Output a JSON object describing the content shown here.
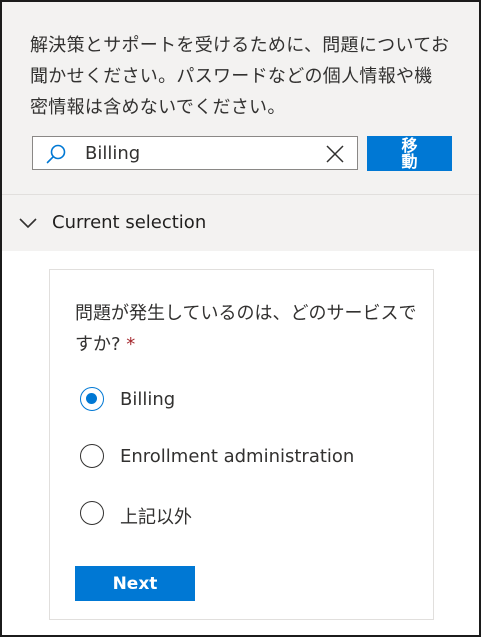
{
  "help": {
    "intro": "解決策とサポートを受けるために、問題についてお聞かせください。パスワードなどの個人情報や機密情報は含めないでください。",
    "search_value": "Billing",
    "search_icon": "search-icon",
    "clear_icon": "close-icon",
    "go_label": "移動"
  },
  "section": {
    "title": "Current selection",
    "expand_icon": "chevron-down-icon"
  },
  "form": {
    "question": "問題が発生しているのは、どのサービスですか?",
    "required_mark": "*",
    "options": [
      {
        "label": "Billing",
        "selected": true
      },
      {
        "label": "Enrollment administration",
        "selected": false
      },
      {
        "label": "上記以外",
        "selected": false
      }
    ],
    "next_label": "Next"
  },
  "colors": {
    "accent": "#0078d4",
    "required": "#a4262c",
    "panel_bg": "#f3f2f1"
  }
}
